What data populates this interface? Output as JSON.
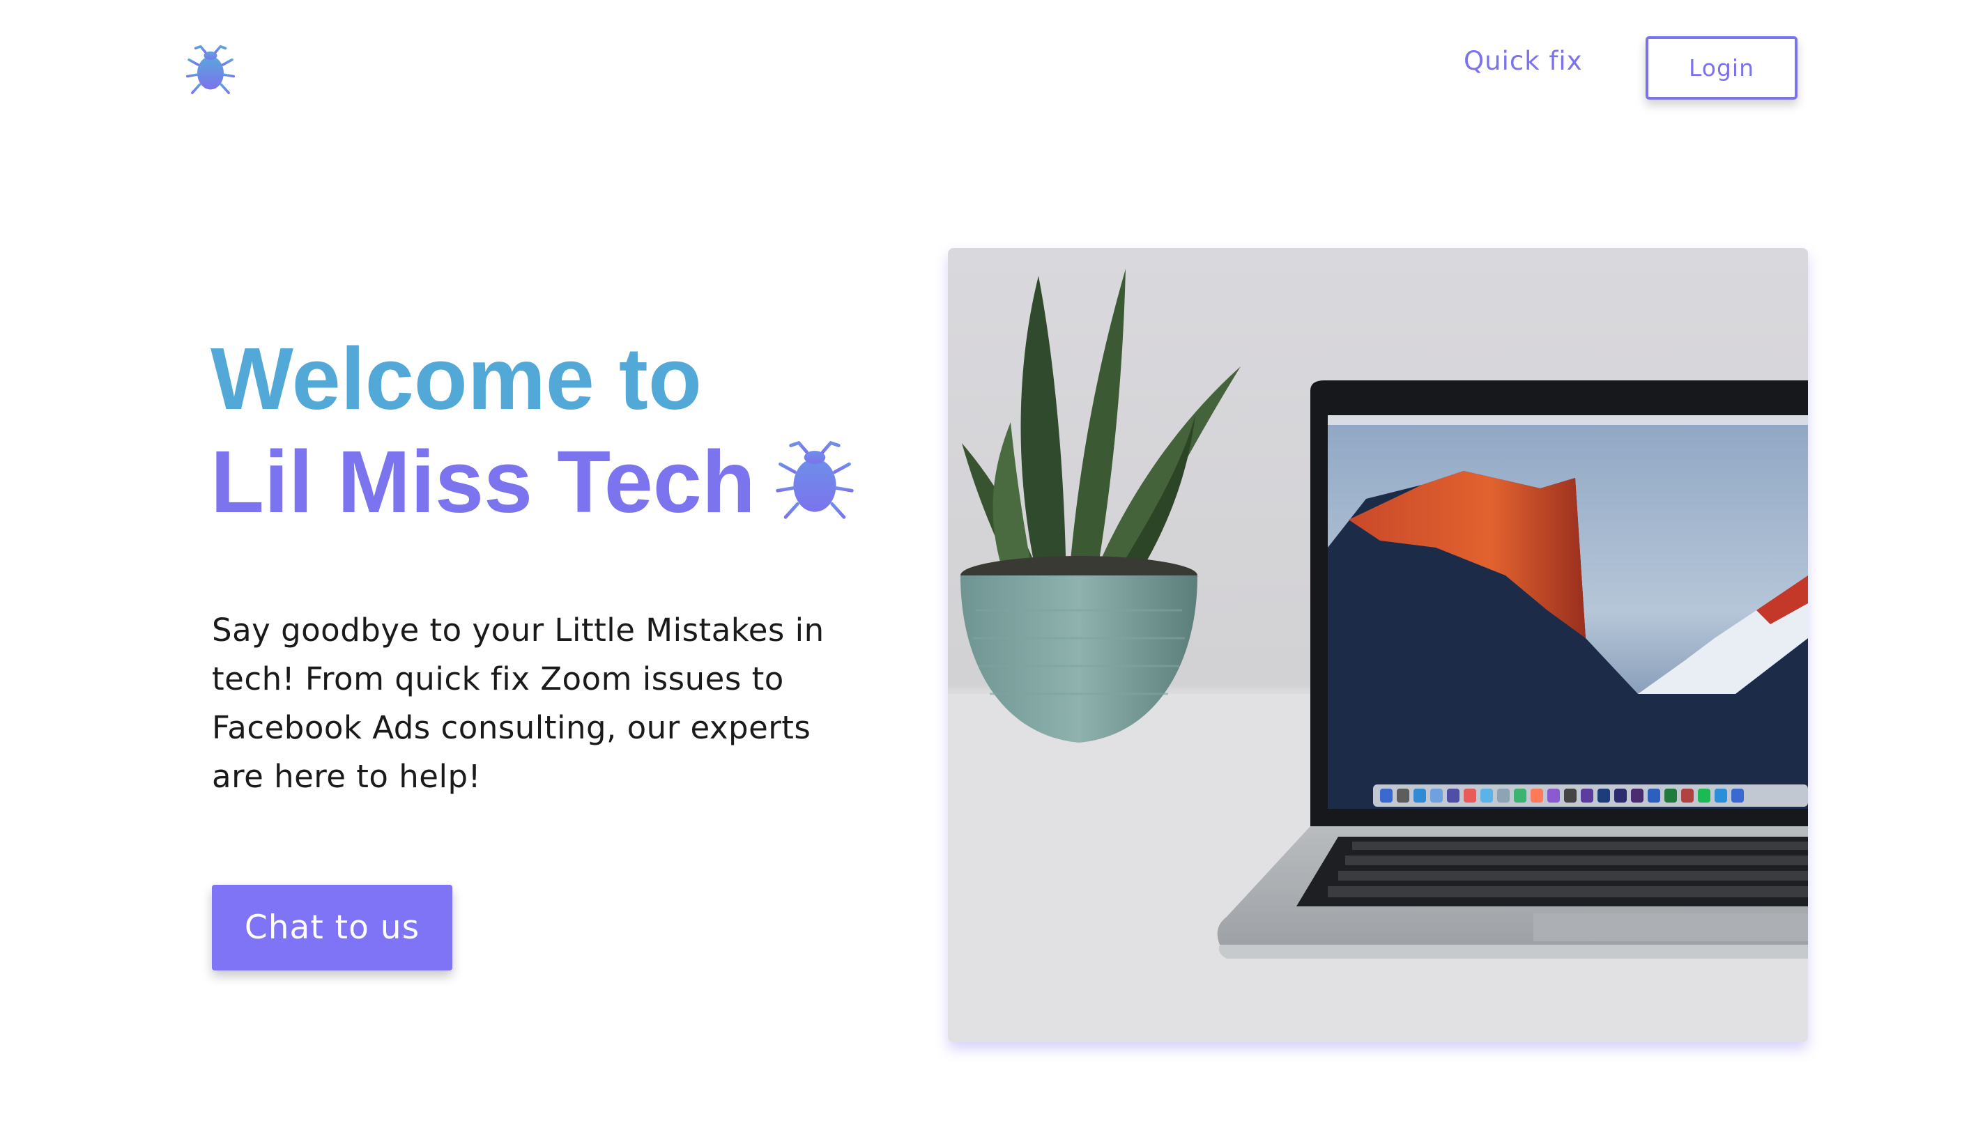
{
  "header": {
    "logo_icon": "bug-icon",
    "nav": {
      "quick_fix_label": "Quick fix"
    },
    "login_label": "Login"
  },
  "hero": {
    "title_line1": "Welcome to",
    "title_line2": "Lil Miss Tech",
    "title_icon": "bug-icon",
    "description": "Say goodbye to your Little Mistakes in tech! From quick fix Zoom issues to Facebook Ads consulting, our experts are here to help!",
    "cta_label": "Chat to us",
    "image_icon": "laptop-and-plant-photo"
  },
  "colors": {
    "accent": "#7b73ee",
    "title_gradient_start": "#52a9d8",
    "title_gradient_end": "#7c73ee",
    "cta_background": "#7f73f6"
  }
}
